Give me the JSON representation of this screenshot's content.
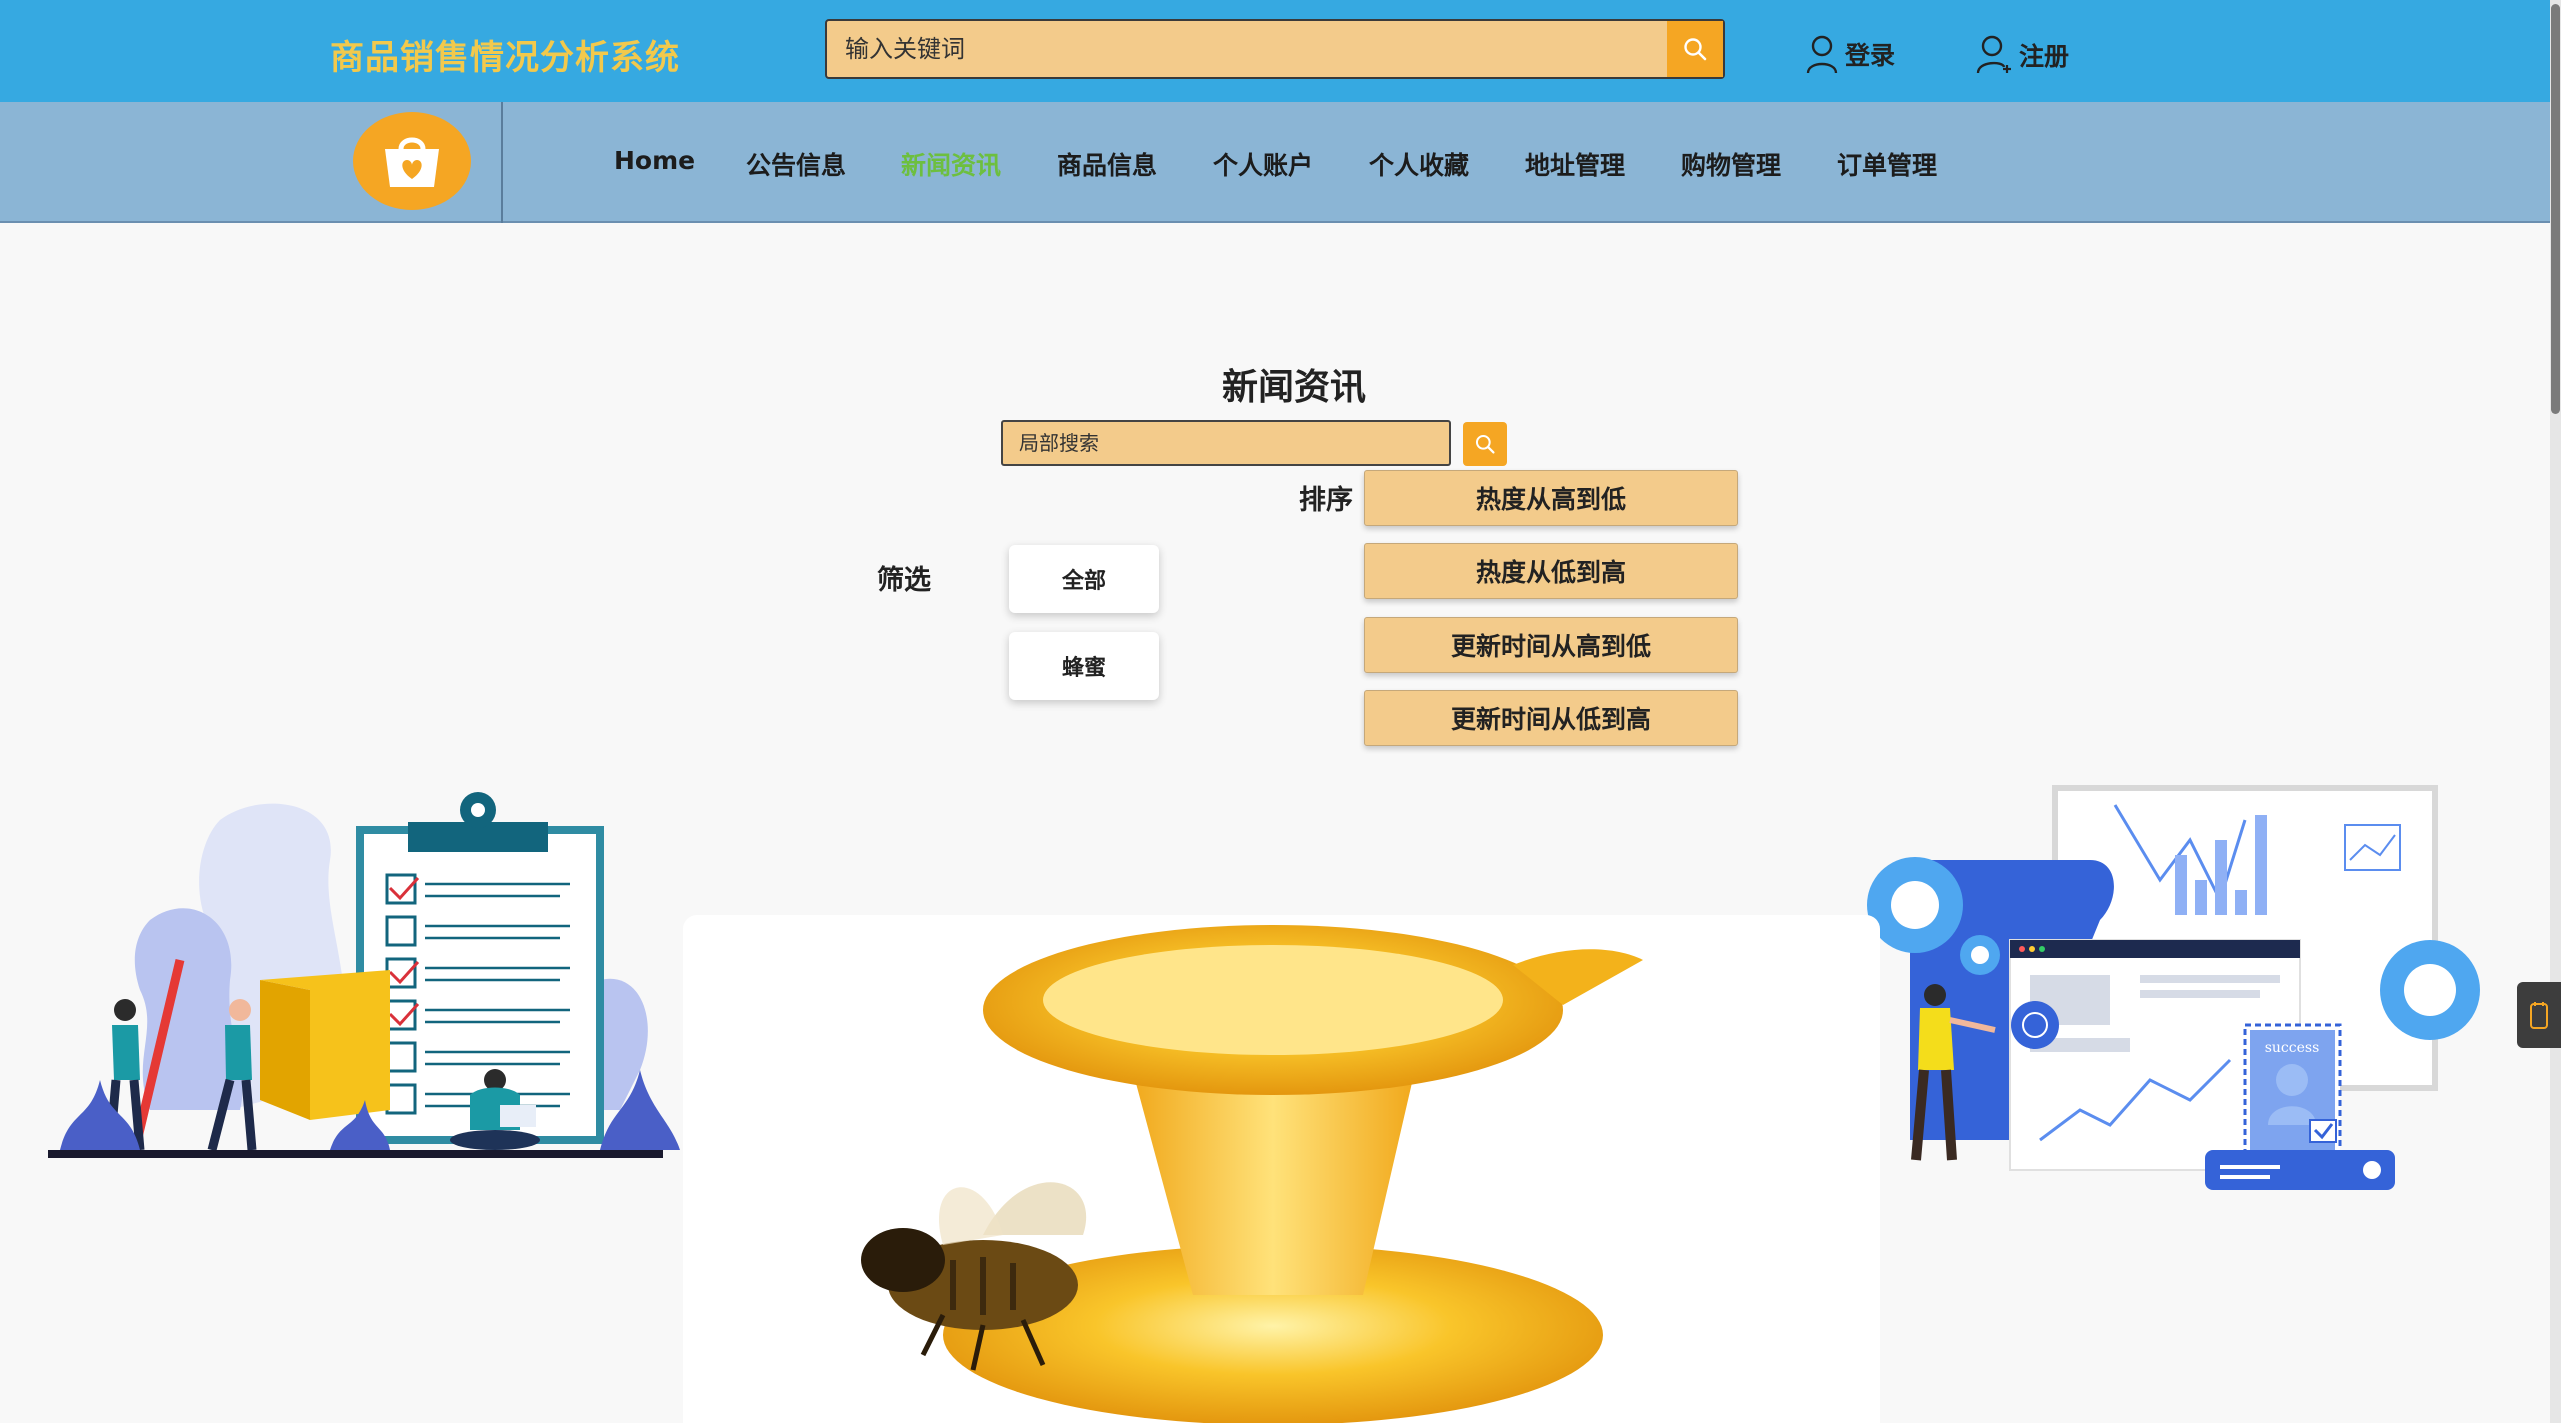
{
  "header": {
    "brand": "商品销售情况分析系统",
    "search_placeholder": "输入关键词",
    "login_label": "登录",
    "register_label": "注册"
  },
  "nav": {
    "items": [
      {
        "label": "Home",
        "active": false
      },
      {
        "label": "公告信息",
        "active": false
      },
      {
        "label": "新闻资讯",
        "active": true
      },
      {
        "label": "商品信息",
        "active": false
      },
      {
        "label": "个人账户",
        "active": false
      },
      {
        "label": "个人收藏",
        "active": false
      },
      {
        "label": "地址管理",
        "active": false
      },
      {
        "label": "购物管理",
        "active": false
      },
      {
        "label": "订单管理",
        "active": false
      }
    ]
  },
  "main": {
    "title": "新闻资讯",
    "local_search_placeholder": "局部搜索",
    "sort_label": "排序",
    "sort_options": [
      "热度从高到低",
      "热度从低到高",
      "更新时间从高到低",
      "更新时间从低到高"
    ],
    "filter_label": "筛选",
    "filter_options": [
      "全部",
      "蜂蜜"
    ]
  },
  "illustration": {
    "badge_text": "success"
  },
  "colors": {
    "topbar": "#36a9e1",
    "navbar": "#8bb5d5",
    "brand_text": "#f2c94c",
    "accent": "#f5a623",
    "button_fill": "#f3cb8b",
    "active_nav": "#6dbf3f"
  },
  "icons": [
    "search-icon",
    "user-icon",
    "user-add-icon",
    "bag-heart-icon",
    "tablet-icon"
  ]
}
